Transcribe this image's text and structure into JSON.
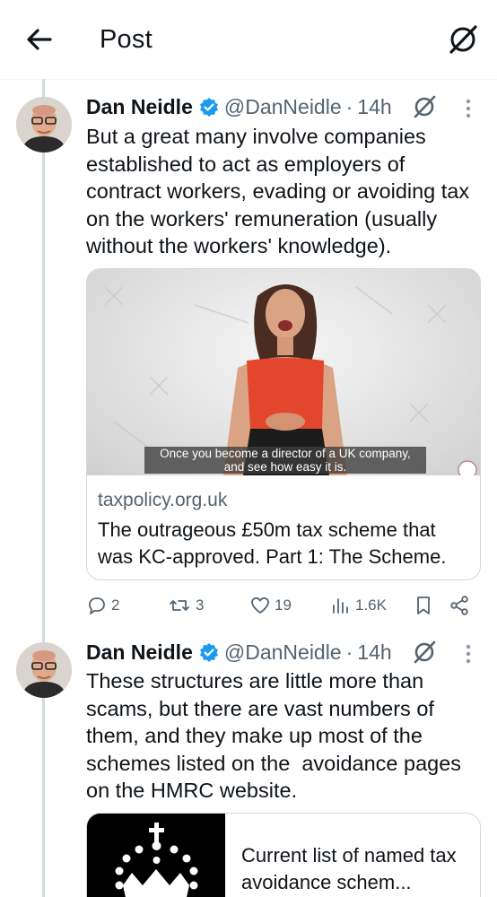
{
  "header": {
    "title": "Post",
    "back_icon": "arrow-left-icon",
    "grok_icon": "grok-icon"
  },
  "tweets": [
    {
      "author_name": "Dan Neidle",
      "handle": "@DanNeidle",
      "separator": "·",
      "time": "14h",
      "text": "But a great many involve companies established to act as employers of contract workers, evading or avoiding tax on the workers' remuneration (usually without the workers' knowledge).",
      "card": {
        "caption_line1": "Once you become a director of a UK company,",
        "caption_line2": "and see how easy it is.",
        "domain": "taxpolicy.org.uk",
        "title": "The outrageous £50m tax scheme that was KC-approved. Part 1: The Scheme."
      },
      "actions": {
        "replies": "2",
        "reposts": "3",
        "likes": "19",
        "views": "1.6K"
      }
    },
    {
      "author_name": "Dan Neidle",
      "handle": "@DanNeidle",
      "separator": "·",
      "time": "14h",
      "text": "These structures are little more than scams, but there are vast numbers of them, and they make up most of the schemes listed on the  avoidance pages on the HMRC website.",
      "card": {
        "title": "Current list of named tax avoidance schem..."
      }
    }
  ],
  "colors": {
    "text": "#0f1419",
    "secondary": "#536471",
    "verified": "#1d9bf0",
    "border": "#cfd9de"
  }
}
